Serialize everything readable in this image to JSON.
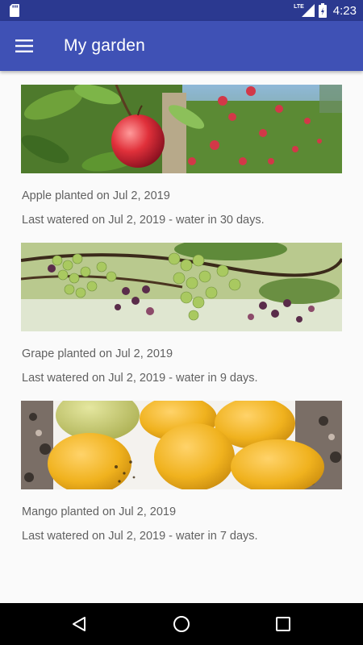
{
  "status_bar": {
    "time": "4:23",
    "network": "LTE",
    "icons": [
      "sd-card-icon",
      "signal-icon",
      "battery-icon"
    ]
  },
  "app_bar": {
    "title": "My garden",
    "menu_icon": "hamburger-menu-icon"
  },
  "plants": [
    {
      "name": "Apple",
      "photo_subject": "apple-tree",
      "planted_text": "Apple planted on Jul 2, 2019",
      "watered_text": "Last watered on Jul 2, 2019 - water in 30 days."
    },
    {
      "name": "Grape",
      "photo_subject": "grape-vine",
      "planted_text": "Grape planted on Jul 2, 2019",
      "watered_text": "Last watered on Jul 2, 2019 - water in 9 days."
    },
    {
      "name": "Mango",
      "photo_subject": "mangoes-on-plate",
      "planted_text": "Mango planted on Jul 2, 2019",
      "watered_text": "Last watered on Jul 2, 2019 - water in 7 days."
    }
  ],
  "nav_bar": {
    "icons": [
      "back-icon",
      "home-icon",
      "recents-icon"
    ]
  },
  "colors": {
    "status_bar": "#2b3990",
    "app_bar": "#3f51b5",
    "background": "#fafafa",
    "secondary_text": "#616161",
    "nav_bar": "#000000"
  }
}
